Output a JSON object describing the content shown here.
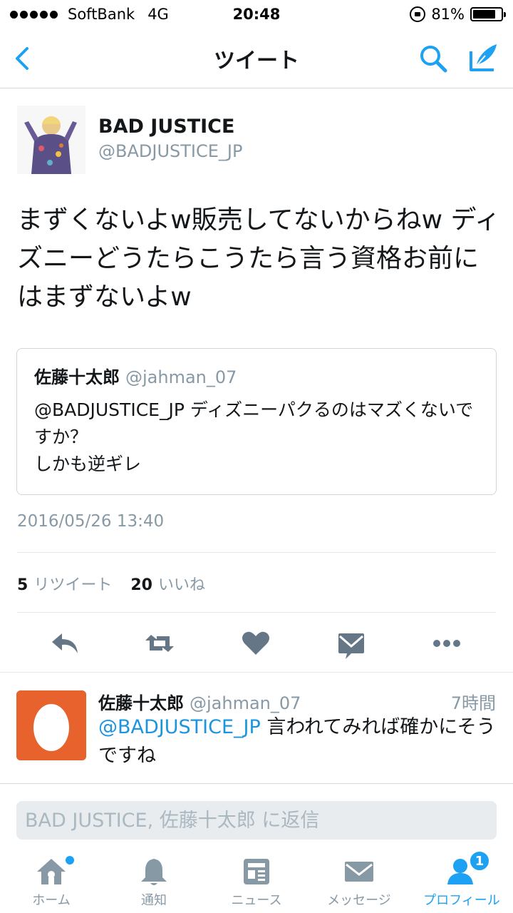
{
  "status_bar": {
    "carrier": "SoftBank",
    "network": "4G",
    "time": "20:48",
    "battery": "81%",
    "battery_level": 0.81
  },
  "nav": {
    "title": "ツイート",
    "icons": [
      "back-chevron-icon",
      "search-icon",
      "compose-icon"
    ]
  },
  "tweet": {
    "author_name": "BAD JUSTICE",
    "author_handle": "@BADJUSTICE_JP",
    "text": "まずくないよw販売してないからねw ディズニーどうたらこうたら言う資格お前にはまずないよw",
    "quote": {
      "name": "佐藤十太郎",
      "handle": "@jahman_07",
      "text": "@BADJUSTICE_JP ディズニーパクるのはマズくないですか？\nしかも逆ギレ"
    },
    "timestamp": "2016/05/26 13:40",
    "retweet_count": "5",
    "retweet_label": "リツイート",
    "like_count": "20",
    "like_label": "いいね"
  },
  "reply": {
    "name": "佐藤十太郎",
    "handle": "@jahman_07",
    "time": "7時間",
    "mention": "@BADJUSTICE_JP",
    "text": " 言われてみれば確かにそうですね"
  },
  "reply_bar": {
    "placeholder": "BAD JUSTICE, 佐藤十太郎 に返信"
  },
  "tabs": [
    {
      "label": "ホーム",
      "icon": "home-icon"
    },
    {
      "label": "通知",
      "icon": "bell-icon"
    },
    {
      "label": "ニュース",
      "icon": "news-icon"
    },
    {
      "label": "メッセージ",
      "icon": "envelope-icon"
    },
    {
      "label": "プロフィール",
      "icon": "profile-icon",
      "badge": "1"
    }
  ],
  "colors": {
    "accent": "#1da1f2",
    "muted": "#8899a6",
    "icon_gray": "#657786",
    "egg_orange": "#e7622c"
  }
}
